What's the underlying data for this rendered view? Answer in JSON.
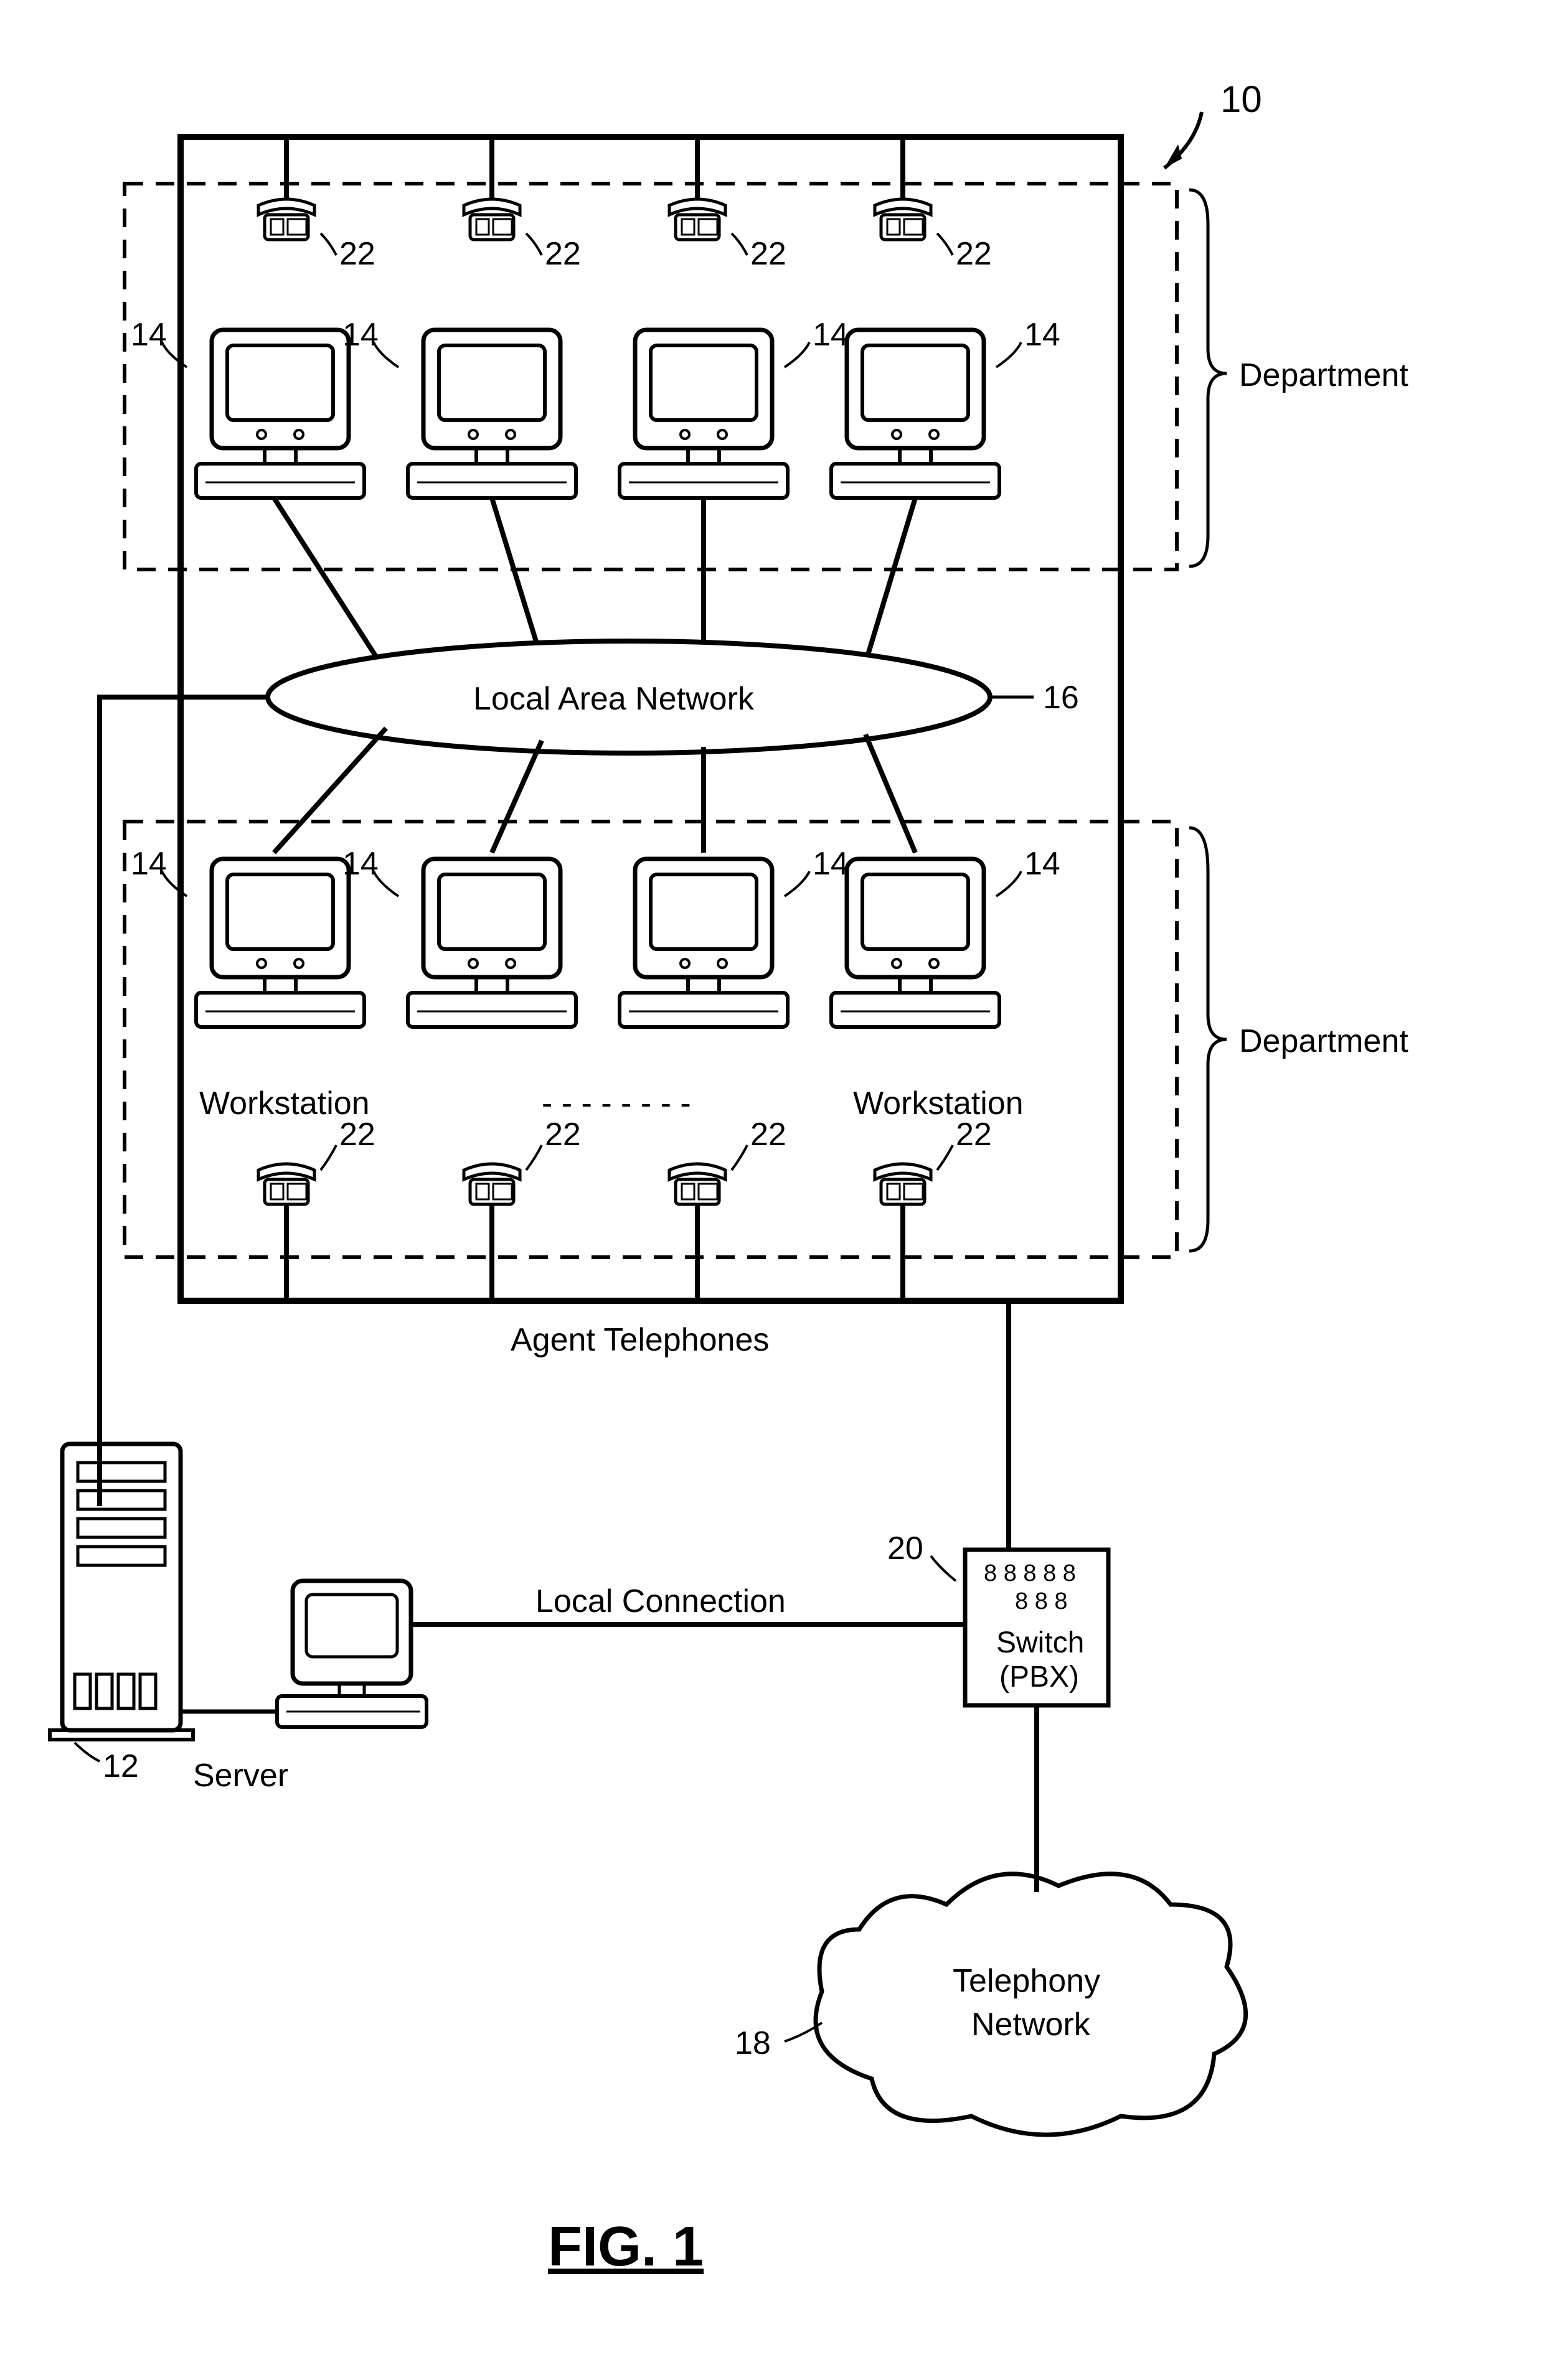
{
  "diagram_ref_arrow": "10",
  "department_label": "Department",
  "workstation_num": "14",
  "phone_num": "22",
  "lan_label": "Local Area Network",
  "lan_num": "16",
  "workstation_label": "Workstation",
  "ellipsis_dots": "- - - - - - - -",
  "agent_phones_label": "Agent Telephones",
  "server_num": "12",
  "server_label": "Server",
  "local_conn_label": "Local Connection",
  "switch_num": "20",
  "switch_label_1": "Switch",
  "switch_label_2": "(PBX)",
  "telephony_label_1": "Telephony",
  "telephony_label_2": "Network",
  "telephony_num": "18",
  "figure_label": "FIG. 1"
}
